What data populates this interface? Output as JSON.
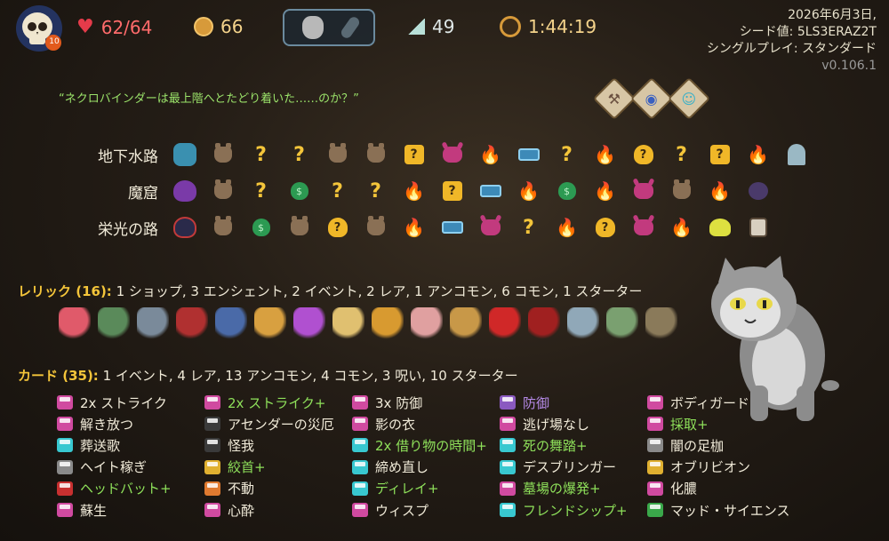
{
  "topbar": {
    "ascension": "10",
    "hp": "62/64",
    "gold": "66",
    "floor": "49",
    "time": "1:44:19",
    "potions": [
      "stone-potion",
      "empty-slot"
    ]
  },
  "run_info": {
    "date": "2026年6月3日,",
    "seed": "シード値: 5LS3ERAZ2T",
    "mode": "シングルプレイ: スタンダード",
    "version": "v0.106.1"
  },
  "quote": "“ネクロバインダーは最上階へとたどり着いた……のか？”",
  "boss_relics": [
    "hammer-relic",
    "mirror-relic",
    "cheer-relic"
  ],
  "acts": [
    {
      "label": "地下水路",
      "nodes": [
        "boss1",
        "monster",
        "q",
        "q",
        "monster",
        "monster",
        "qface",
        "elite",
        "fire",
        "chest",
        "q",
        "fire",
        "mask",
        "q",
        "qface",
        "fire",
        "bell"
      ]
    },
    {
      "label": "魔窟",
      "nodes": [
        "boss2",
        "monster",
        "q",
        "bag",
        "q",
        "q",
        "fire",
        "qface",
        "chest",
        "fire",
        "bag",
        "fire",
        "elite",
        "monster",
        "fire",
        "spider"
      ]
    },
    {
      "label": "栄光の路",
      "nodes": [
        "boss3",
        "monster",
        "bag",
        "monster",
        "mask",
        "monster",
        "fire",
        "chest",
        "elite",
        "q",
        "fire",
        "mask",
        "elite",
        "fire",
        "slime",
        "robot"
      ]
    }
  ],
  "relics": {
    "heading": "レリック (16):",
    "summary": " 1 ショップ, 3 エンシェント, 2 イベント, 2 レア, 1 アンコモン, 6 コモン, 1 スターター",
    "items": [
      {
        "name": "heart-relic",
        "color": "#e05a6a"
      },
      {
        "name": "orb-relic",
        "color": "#5a8a5a"
      },
      {
        "name": "helmet-relic",
        "color": "#7a8a9a"
      },
      {
        "name": "pillow-relic",
        "color": "#b03030"
      },
      {
        "name": "book-relic",
        "color": "#4a6aa8"
      },
      {
        "name": "pyramid-relic",
        "color": "#d8a040"
      },
      {
        "name": "crystal-ball-relic",
        "color": "#b050d0"
      },
      {
        "name": "doll-relic",
        "color": "#e0c070"
      },
      {
        "name": "flower-pot-relic",
        "color": "#d89a30"
      },
      {
        "name": "ice-cream-relic",
        "color": "#e0a0a0"
      },
      {
        "name": "scroll-relic",
        "color": "#c89848"
      },
      {
        "name": "red-envelope-relic",
        "color": "#d02828"
      },
      {
        "name": "rose-relic",
        "color": "#a02020"
      },
      {
        "name": "cloak-relic",
        "color": "#90a8b8"
      },
      {
        "name": "frog-relic",
        "color": "#7aa070"
      },
      {
        "name": "turtle-relic",
        "color": "#8a7a5a"
      }
    ]
  },
  "cards": {
    "heading": "カード (35):",
    "summary": " 1 イベント, 4 レア, 13 アンコモン, 4 コモン, 3 呪い, 10 スターター",
    "columns": [
      [
        {
          "label": "2x ストライク",
          "upgraded": false,
          "color": "#d04aa0"
        },
        {
          "label": "解き放つ",
          "upgraded": false,
          "color": "#d04aa0"
        },
        {
          "label": "葬送歌",
          "upgraded": false,
          "color": "#38c8d0"
        },
        {
          "label": "ヘイト稼ぎ",
          "upgraded": false,
          "color": "#8a8a8a"
        },
        {
          "label": "ヘッドバット+",
          "upgraded": true,
          "color": "#c83030"
        },
        {
          "label": "蘇生",
          "upgraded": false,
          "color": "#d04aa0"
        }
      ],
      [
        {
          "label": "2x ストライク+",
          "upgraded": true,
          "color": "#d04aa0"
        },
        {
          "label": "アセンダーの災厄",
          "upgraded": false,
          "color": "#3a3a3a"
        },
        {
          "label": "怪我",
          "upgraded": false,
          "color": "#3a3a3a"
        },
        {
          "label": "絞首+",
          "upgraded": true,
          "color": "#e0b030"
        },
        {
          "label": "不動",
          "upgraded": false,
          "color": "#e07a30"
        },
        {
          "label": "心酔",
          "upgraded": false,
          "color": "#d04aa0"
        }
      ],
      [
        {
          "label": "3x 防御",
          "upgraded": false,
          "color": "#d04aa0"
        },
        {
          "label": "影の衣",
          "upgraded": false,
          "color": "#d04aa0"
        },
        {
          "label": "2x 借り物の時間+",
          "upgraded": true,
          "color": "#38c8d0"
        },
        {
          "label": "締め直し",
          "upgraded": false,
          "color": "#38c8d0"
        },
        {
          "label": "ディレイ+",
          "upgraded": true,
          "color": "#38c8d0"
        },
        {
          "label": "ウィスプ",
          "upgraded": false,
          "color": "#d04aa0"
        }
      ],
      [
        {
          "label": "防御",
          "upgraded": false,
          "special": true,
          "color": "#8a5ac0"
        },
        {
          "label": "逃げ場なし",
          "upgraded": false,
          "color": "#d04aa0"
        },
        {
          "label": "死の舞踏+",
          "upgraded": true,
          "color": "#38c8d0"
        },
        {
          "label": "デスブリンガー",
          "upgraded": false,
          "color": "#38c8d0"
        },
        {
          "label": "墓場の爆発+",
          "upgraded": true,
          "color": "#d04aa0"
        },
        {
          "label": "フレンドシップ+",
          "upgraded": true,
          "color": "#38c8d0"
        }
      ],
      [
        {
          "label": "ボディガード",
          "upgraded": false,
          "color": "#d04aa0"
        },
        {
          "label": "採取+",
          "upgraded": true,
          "color": "#d04aa0"
        },
        {
          "label": "闇の足枷",
          "upgraded": false,
          "color": "#8a8a8a"
        },
        {
          "label": "オブリビオン",
          "upgraded": false,
          "color": "#e0b030"
        },
        {
          "label": "化膿",
          "upgraded": false,
          "color": "#d04aa0"
        },
        {
          "label": "マッド・サイエンス",
          "upgraded": false,
          "color": "#3aa84a"
        }
      ]
    ]
  }
}
